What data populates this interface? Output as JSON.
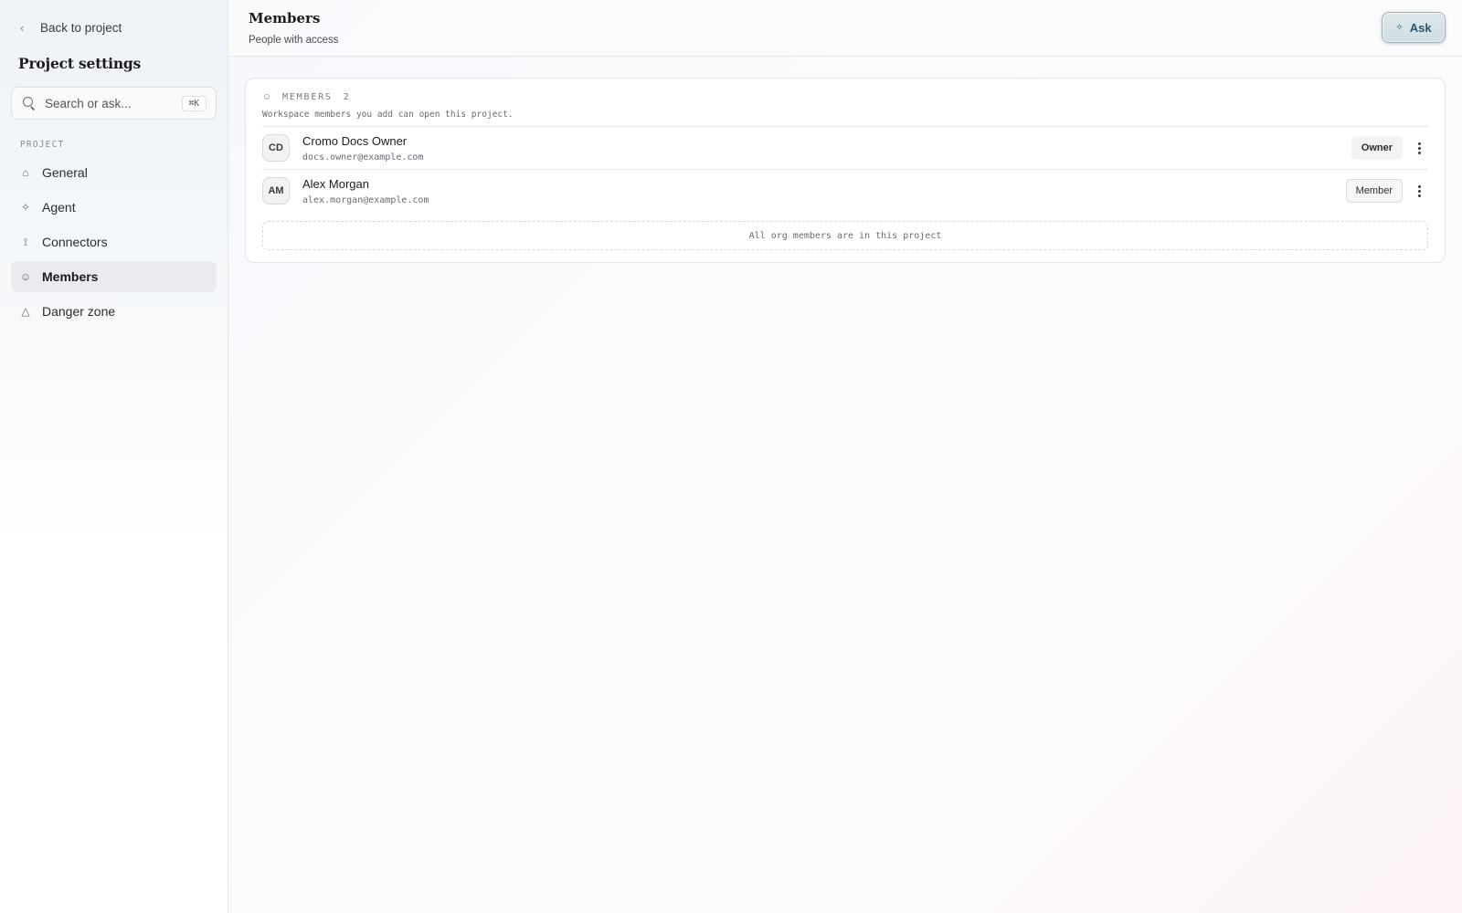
{
  "sidebar": {
    "back_label": "Back to project",
    "title": "Project settings",
    "search": {
      "placeholder": "Search or ask...",
      "shortcut": "⌘K"
    },
    "section_label": "PROJECT",
    "items": [
      {
        "label": "General",
        "icon": "home-icon",
        "active": false
      },
      {
        "label": "Agent",
        "icon": "sparkle-icon",
        "active": false
      },
      {
        "label": "Connectors",
        "icon": "plug-icon",
        "active": false
      },
      {
        "label": "Members",
        "icon": "users-icon",
        "active": true
      },
      {
        "label": "Danger zone",
        "icon": "warning-triangle-icon",
        "active": false
      }
    ]
  },
  "header": {
    "title": "Members",
    "subtitle": "People with access",
    "ask_label": "Ask"
  },
  "members_card": {
    "label": "MEMBERS",
    "count": "2",
    "description": "Workspace members you add can open this project.",
    "members": [
      {
        "initials": "CD",
        "name": "Cromo Docs Owner",
        "email": "docs.owner@example.com",
        "role": "Owner"
      },
      {
        "initials": "AM",
        "name": "Alex Morgan",
        "email": "alex.morgan@example.com",
        "role": "Member"
      }
    ],
    "empty_note": "All org members are in this project"
  },
  "colors": {
    "accent": "#2d5564",
    "active_nav_bg": "#e9ebee",
    "border": "#e3e5ea"
  }
}
